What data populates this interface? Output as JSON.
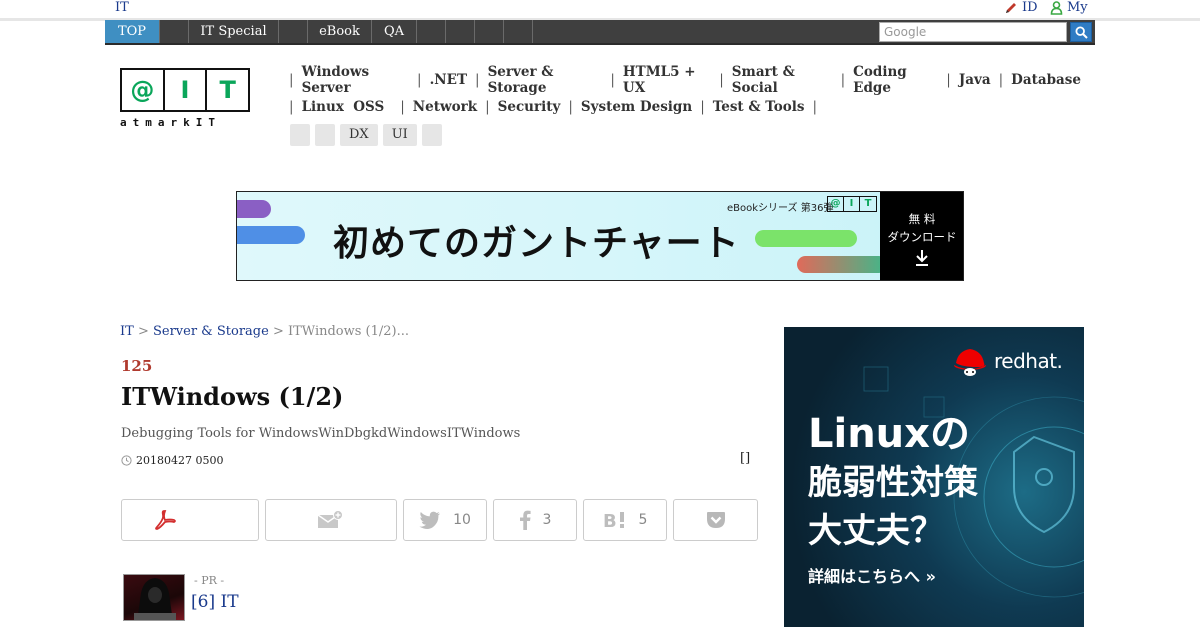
{
  "util": {
    "site": "IT",
    "id_label": "ID",
    "my_label": "My"
  },
  "nav": {
    "tabs": [
      "TOP",
      "",
      "IT Special",
      "",
      "eBook",
      "QA",
      "",
      "",
      "",
      ""
    ],
    "search_placeholder": "Google"
  },
  "logo": {
    "cells": [
      "@",
      "I",
      "T"
    ],
    "sub": "atmarkIT"
  },
  "categories": {
    "row1": [
      "Windows Server",
      ".NET",
      "Server & Storage",
      "HTML5 + UX",
      "Smart & Social",
      "Coding Edge",
      "Java",
      "Database"
    ],
    "row2": [
      "Linux  OSS",
      "Network",
      "Security",
      "System Design",
      "Test & Tools"
    ],
    "chips": [
      "",
      "",
      "DX",
      "UI",
      ""
    ]
  },
  "banner": {
    "headline": "初めてのガントチャート",
    "series": "eBookシリーズ 第36弾",
    "logo_cells": [
      "@",
      "I",
      "T"
    ],
    "download_line1": "無 料",
    "download_line2": "ダウンロード",
    "download_icon": "download-arrow-icon"
  },
  "breadcrumb": {
    "home": "IT",
    "section": "Server & Storage",
    "current": "ITWindows (1/2)..."
  },
  "article": {
    "series_no": "125",
    "title": "ITWindows (1/2)",
    "lead": "Debugging Tools for WindowsWinDbgkdWindowsITWindows",
    "date": "20180427 0500",
    "bracket": "[]"
  },
  "share": {
    "pdf_icon": "pdf-icon",
    "mail_icon": "mail-add-icon",
    "twitter_count": "10",
    "facebook_count": "3",
    "hatena_count": "5",
    "pocket_icon": "pocket-icon"
  },
  "pr": {
    "label": "- PR -",
    "link": "[6] IT"
  },
  "side_ad": {
    "brand": "redhat.",
    "line1": "Linuxの",
    "line2": "脆弱性対策",
    "line3": "大丈夫？",
    "cta": "詳細はこちらへ »"
  },
  "colors": {
    "nav_bg": "#3f3f3f",
    "nav_active": "#3f8fc2",
    "link": "#1a3a8c",
    "accent_red": "#b03a2e",
    "logo_green": "#0aa65a"
  }
}
